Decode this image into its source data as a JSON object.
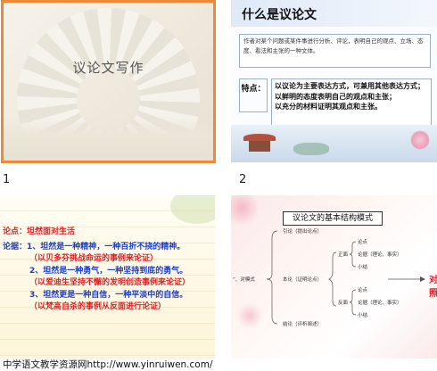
{
  "slides": [
    {
      "number": "1",
      "title": "议论文写作"
    },
    {
      "number": "2",
      "title": "什么是议论文",
      "definition": "作者对某个问题或某件事进行分析、评论，表明自己的观点、立场、态度、看法和主张的一种文体。",
      "feature_label": "特点：",
      "features": [
        "以议论为主要表达方式，可兼用其他表达方式；",
        "以鲜明的态度表明自己的观点和主张；",
        "以充分的材料证明其观点和主张。"
      ]
    },
    {
      "number": "",
      "thesis_label": "论点：",
      "thesis": "坦然面对生活",
      "argument_label": "论据：",
      "arguments": [
        {
          "claim": "1、坦然是一种精神，一种百折不挠的精神。",
          "example": "（以贝多芬挑战命运的事例来论证）"
        },
        {
          "claim": "2、坦然是一种勇气，一种坚持到底的勇气。",
          "example": "（以爱迪生坚持不懈的发明创造事例来论证）"
        },
        {
          "claim": "3、坦然更是一种自信，一种平淡中的自信。",
          "example": "（以梵高自杀的事例从反面进行论证）"
        }
      ]
    },
    {
      "number": "",
      "title": "议论文的基本结构模式",
      "labels": {
        "intro": "引论（提出论点）",
        "model": "“、对模式",
        "body": "本论（证明论点）",
        "positive": "正面",
        "negative": "反面",
        "point": "论点",
        "evidence": "论据（理论、事实）",
        "summary": "小结",
        "conclusion": "结论（评析阐述）",
        "side": "对照"
      }
    }
  ],
  "footer": "中学语文教学资源网http://www.yinruiwen.com/"
}
